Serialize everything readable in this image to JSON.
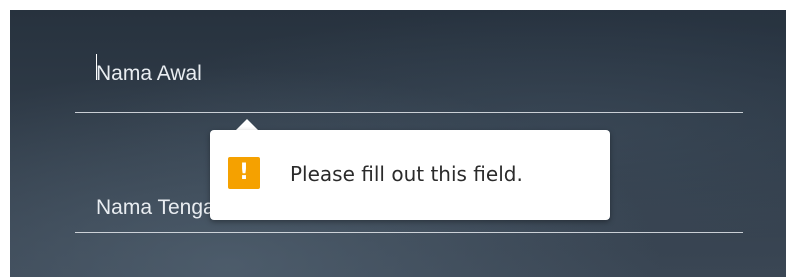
{
  "form": {
    "first_name": {
      "placeholder": "Nama Awal",
      "value": ""
    },
    "last_name": {
      "placeholder": "Nama Tengah",
      "value": ""
    }
  },
  "validation_tooltip": {
    "icon": "warning-icon",
    "icon_symbol": "!",
    "icon_color": "#f5a100",
    "message": "Please fill out this field."
  }
}
